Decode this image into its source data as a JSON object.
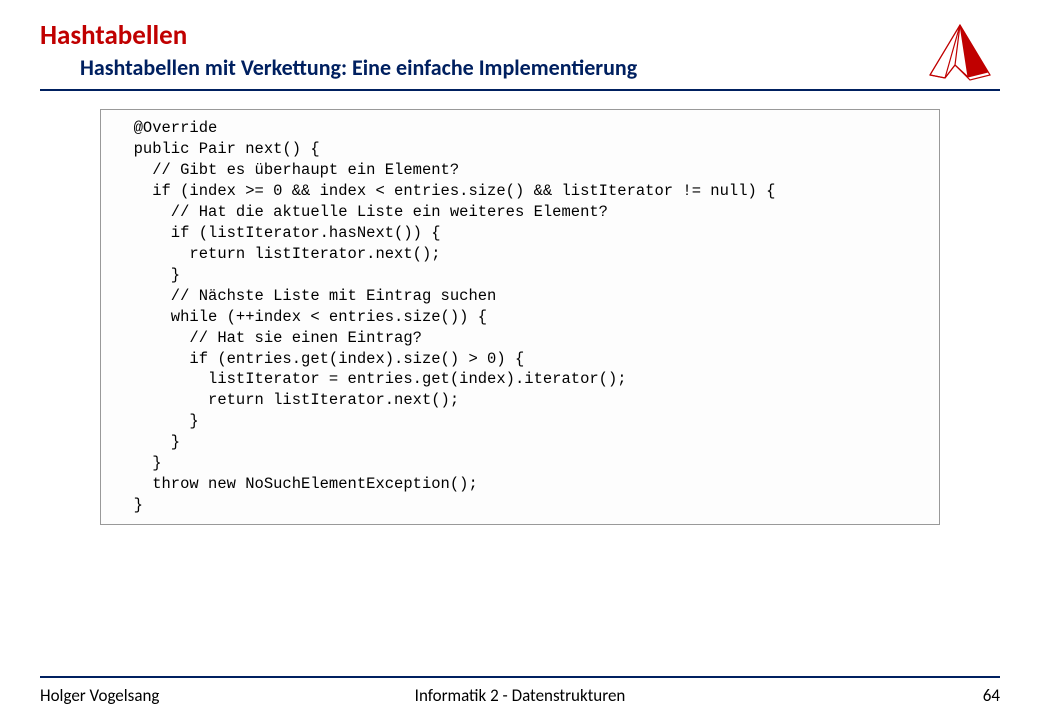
{
  "header": {
    "title": "Hashtabellen",
    "subtitle": "Hashtabellen mit Verkettung: Eine einfache Implementierung"
  },
  "code": "  @Override\n  public Pair next() {\n    // Gibt es überhaupt ein Element?\n    if (index >= 0 && index < entries.size() && listIterator != null) {\n      // Hat die aktuelle Liste ein weiteres Element?\n      if (listIterator.hasNext()) {\n        return listIterator.next();\n      }\n      // Nächste Liste mit Eintrag suchen\n      while (++index < entries.size()) {\n        // Hat sie einen Eintrag?\n        if (entries.get(index).size() > 0) {\n          listIterator = entries.get(index).iterator();\n          return listIterator.next();\n        }\n      }\n    }\n    throw new NoSuchElementException();\n  }",
  "footer": {
    "author": "Holger Vogelsang",
    "course": "Informatik 2 - Datenstrukturen",
    "page": "64"
  }
}
